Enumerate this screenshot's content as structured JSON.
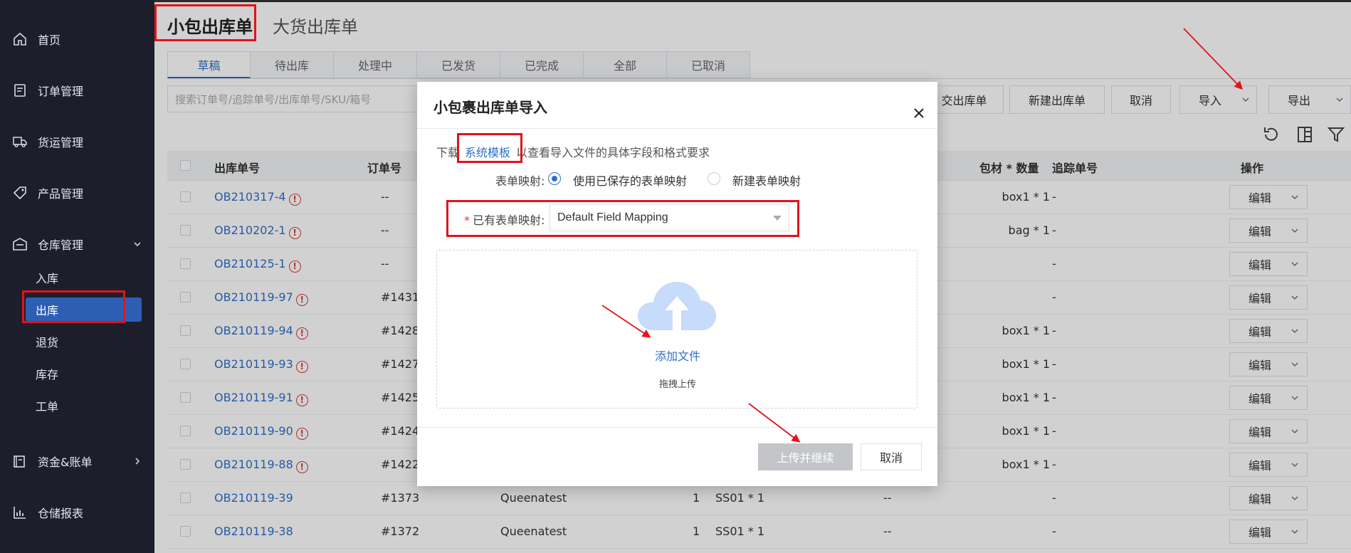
{
  "sidebar": {
    "items": [
      {
        "label": "首页",
        "icon": "home-icon"
      },
      {
        "label": "订单管理",
        "icon": "order-icon"
      },
      {
        "label": "货运管理",
        "icon": "truck-icon"
      },
      {
        "label": "产品管理",
        "icon": "tag-icon"
      },
      {
        "label": "仓库管理",
        "icon": "warehouse-icon"
      },
      {
        "label": "资金&账单",
        "icon": "ledger-icon"
      },
      {
        "label": "仓储报表",
        "icon": "chart-icon"
      }
    ],
    "sub_items": [
      {
        "label": "入库"
      },
      {
        "label": "出库"
      },
      {
        "label": "退货"
      },
      {
        "label": "库存"
      },
      {
        "label": "工单"
      }
    ]
  },
  "page": {
    "tab_small": "小包出库单",
    "tab_large": "大货出库单",
    "status_tabs": [
      "草稿",
      "待出库",
      "处理中",
      "已发货",
      "已完成",
      "全部",
      "已取消"
    ],
    "search_placeholder": "搜索订单号/追踪单号/出库单号/SKU/箱号",
    "toolbar": {
      "submit": "交出库单",
      "create": "新建出库单",
      "cancel": "取消",
      "import": "导入",
      "export": "导出"
    }
  },
  "table": {
    "headers": {
      "outbound_no": "出库单号",
      "order_no": "订单号",
      "packaging": "包材 * 数量",
      "tracking": "追踪单号",
      "ops": "操作"
    },
    "edit_label": "编辑",
    "rows": [
      {
        "id": "OB210317-4",
        "order": "--",
        "store": "",
        "qty": "",
        "sku": "",
        "col6": "",
        "pack": "box1 * 1",
        "track": "-",
        "warn": true
      },
      {
        "id": "OB210202-1",
        "order": "--",
        "store": "",
        "qty": "",
        "sku": "",
        "col6": "",
        "pack": "bag * 1",
        "track": "-",
        "warn": true
      },
      {
        "id": "OB210125-1",
        "order": "--",
        "store": "",
        "qty": "",
        "sku": "",
        "col6": "",
        "pack": "",
        "track": "-",
        "warn": true
      },
      {
        "id": "OB210119-97",
        "order": "#1431",
        "store": "",
        "qty": "",
        "sku": "",
        "col6": "",
        "pack": "",
        "track": "-",
        "warn": true
      },
      {
        "id": "OB210119-94",
        "order": "#1428",
        "store": "",
        "qty": "",
        "sku": "",
        "col6": "",
        "pack": "box1 * 1",
        "track": "-",
        "warn": true
      },
      {
        "id": "OB210119-93",
        "order": "#1427",
        "store": "",
        "qty": "",
        "sku": "",
        "col6": "",
        "pack": "box1 * 1",
        "track": "-",
        "warn": true
      },
      {
        "id": "OB210119-91",
        "order": "#1425",
        "store": "",
        "qty": "",
        "sku": "",
        "col6": "",
        "pack": "box1 * 1",
        "track": "-",
        "warn": true
      },
      {
        "id": "OB210119-90",
        "order": "#1424",
        "store": "",
        "qty": "",
        "sku": "",
        "col6": "",
        "pack": "box1 * 1",
        "track": "-",
        "warn": true
      },
      {
        "id": "OB210119-88",
        "order": "#1422",
        "store": "",
        "qty": "",
        "sku": "",
        "col6": "",
        "pack": "box1 * 1",
        "track": "-",
        "warn": true
      },
      {
        "id": "OB210119-39",
        "order": "#1373",
        "store": "Queenatest",
        "qty": "1",
        "sku": "SS01 * 1",
        "col6": "--",
        "pack": "",
        "track": "-",
        "warn": false
      },
      {
        "id": "OB210119-38",
        "order": "#1372",
        "store": "Queenatest",
        "qty": "1",
        "sku": "SS01 * 1",
        "col6": "--",
        "pack": "",
        "track": "-",
        "warn": false
      }
    ]
  },
  "modal": {
    "title": "小包裹出库单导入",
    "download_prefix": "下载",
    "template_link": "系统模板",
    "download_suffix": "以查看导入文件的具体字段和格式要求",
    "mapping_label": "表单映射:",
    "option_saved": "使用已保存的表单映射",
    "option_new": "新建表单映射",
    "existing_label": "已有表单映射:",
    "existing_value": "Default Field Mapping",
    "add_file": "添加文件",
    "drag_tip": "拖拽上传",
    "upload_button": "上传并继续",
    "cancel_button": "取消"
  },
  "colors": {
    "sidebar_bg": "#1c1f2b",
    "accent": "#2c6fcc",
    "annotation": "#e0141b",
    "disabled_btn": "#c3c5c9"
  }
}
